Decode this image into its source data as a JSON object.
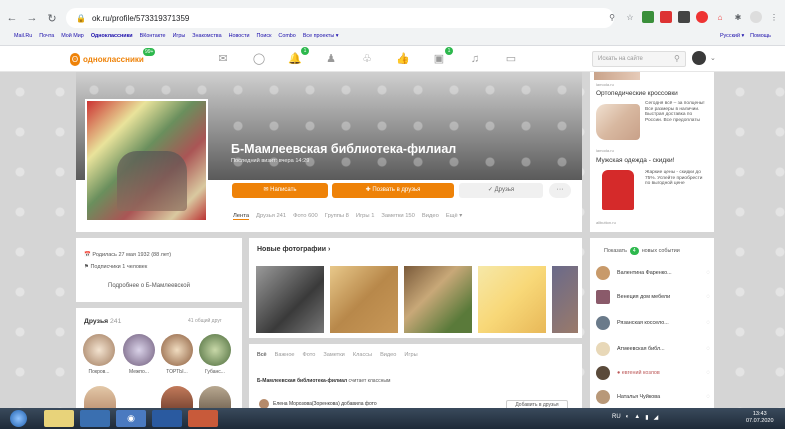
{
  "browser": {
    "url": "ok.ru/profile/573319371359",
    "bookmarks": [
      "Mail.Ru",
      "Почта",
      "Мой Мир",
      "Одноклассники",
      "ВКонтакте",
      "Игры",
      "Знакомства",
      "Новости",
      "Поиск",
      "Combo",
      "Все проекты ▾"
    ],
    "bookmarks_right": [
      "Русский ▾",
      "Помощь"
    ]
  },
  "ok_header": {
    "logo_text": "одноклассники",
    "logo_badge": "99+",
    "nav_counts": {
      "notifications": "1",
      "photos": "1"
    },
    "search_placeholder": "Искать на сайте"
  },
  "profile": {
    "name": "Б-Мамлеевская библиотека-филиал",
    "last_visit": "Последний визит: вчера 14:29",
    "buttons": {
      "write": "✉ Написать",
      "invite": "✚ Позвать в друзья",
      "friends": "✓ Друзья",
      "more": "···"
    },
    "tabs": [
      "Лента",
      "Друзья 241",
      "Фото 600",
      "Группы 8",
      "Игры 1",
      "Заметки 150",
      "Видео",
      "Ещё ▾"
    ]
  },
  "info": {
    "registered": "Родилась 27 мая 1932 (88 лет)",
    "subscribers": "Подписчики 1 человек",
    "more": "Подробнее о Б-Мамлеевской"
  },
  "friends": {
    "title": "Друзья",
    "count": "241",
    "common": "41 общий друг",
    "items": [
      {
        "name": "Покров..."
      },
      {
        "name": "Межпо..."
      },
      {
        "name": "ТОРТЫ..."
      },
      {
        "name": "Губанс..."
      }
    ]
  },
  "photos": {
    "title": "Новые фотографии ›"
  },
  "feed": {
    "tabs": [
      "Всё",
      "Важное",
      "Фото",
      "Заметки",
      "Классы",
      "Видео",
      "Игры"
    ],
    "line_owner": "Б-Мамлеевская библиотека-филиал",
    "line_rest": " считает классным",
    "post_author": "Елена Морозова(Зоренкова) добавила фото",
    "add_button": "Добавить в друзья"
  },
  "ads": [
    {
      "src": "lamoda.ru",
      "title": "Ортопедические кроссовки",
      "text": "Сегодня всё – за полцены! Все размеры в наличии. Быстрая доставка по России. Все предоплаты"
    },
    {
      "src": "lamoda.ru",
      "title": "Мужская одежда - скидки!",
      "text": "Жаркие цены - скидки до 75%. Успейте приобрести по выгодной цене"
    },
    {
      "src": "allbutton.ru"
    }
  ],
  "events": {
    "show_label": "Показать",
    "count": "4",
    "new_label": "новых событии",
    "items": [
      {
        "name": "Валентина Фаренко..."
      },
      {
        "name": "Венеция дом мебели"
      },
      {
        "name": "Рязанская коссело..."
      },
      {
        "name": "Атмеевская библ..."
      },
      {
        "name": "● евгений козлов"
      },
      {
        "name": "Наталья Чуйкова"
      }
    ]
  },
  "taskbar": {
    "lang": "RU",
    "time": "13:43",
    "date": "07.07.2020"
  },
  "colors": {
    "accent": "#ee8208",
    "counter": "#2db84d"
  }
}
